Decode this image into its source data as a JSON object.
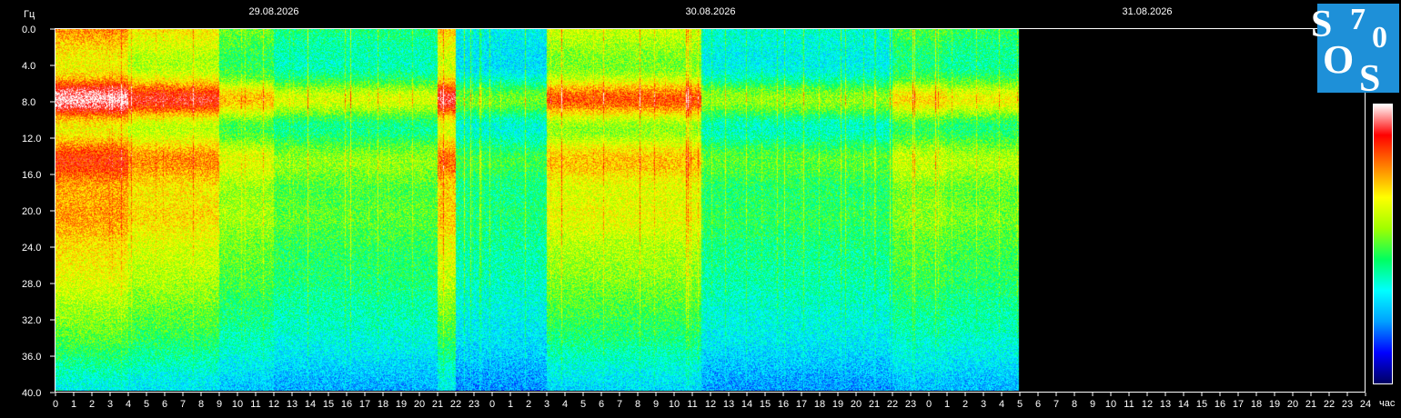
{
  "chart_data": {
    "type": "heatmap",
    "y_unit": "Гц",
    "x_unit": "час",
    "dates": [
      "29.08.2026",
      "30.08.2026",
      "31.08.2026"
    ],
    "y_ticks": [
      "0.0",
      "4.0",
      "8.0",
      "12.0",
      "16.0",
      "20.0",
      "24.0",
      "28.0",
      "32.0",
      "36.0",
      "40.0"
    ],
    "ylim": [
      0,
      40
    ],
    "x_hour_ticks": [
      "0",
      "1",
      "2",
      "3",
      "4",
      "5",
      "6",
      "7",
      "8",
      "9",
      "10",
      "11",
      "12",
      "13",
      "14",
      "15",
      "16",
      "17",
      "18",
      "19",
      "20",
      "21",
      "22",
      "23",
      "0",
      "1",
      "2",
      "3",
      "4",
      "5",
      "6",
      "7",
      "8",
      "9",
      "10",
      "11",
      "12",
      "13",
      "14",
      "15",
      "16",
      "17",
      "18",
      "19",
      "20",
      "21",
      "22",
      "23",
      "0",
      "1",
      "2",
      "3",
      "4",
      "5",
      "6",
      "7",
      "8",
      "9",
      "10",
      "11",
      "12",
      "13",
      "14",
      "15",
      "16",
      "17",
      "18",
      "19",
      "20",
      "21",
      "22",
      "23",
      "24"
    ],
    "total_hours": 72,
    "data_end_hour": 53,
    "resonance_bands_hz": [
      7.8,
      14.3,
      20.0,
      26.0,
      33.0
    ],
    "activity_segments": [
      {
        "from_hour": 0,
        "to_hour": 4,
        "level": 1.0
      },
      {
        "from_hour": 4,
        "to_hour": 9,
        "level": 0.85
      },
      {
        "from_hour": 9,
        "to_hour": 12,
        "level": 0.6
      },
      {
        "from_hour": 12,
        "to_hour": 21,
        "level": 0.45
      },
      {
        "from_hour": 21,
        "to_hour": 22,
        "level": 0.9
      },
      {
        "from_hour": 22,
        "to_hour": 27,
        "level": 0.3
      },
      {
        "from_hour": 27,
        "to_hour": 35.5,
        "level": 0.75
      },
      {
        "from_hour": 35.5,
        "to_hour": 46,
        "level": 0.35
      },
      {
        "from_hour": 46,
        "to_hour": 49,
        "level": 0.55
      },
      {
        "from_hour": 49,
        "to_hour": 53,
        "level": 0.5
      }
    ],
    "colorbar": [
      "#000060",
      "#0000ff",
      "#00a0ff",
      "#00ffff",
      "#00ff60",
      "#a0ff00",
      "#ffff00",
      "#ff8000",
      "#ff0000",
      "#ffffff"
    ],
    "colors": {
      "background": "#000000",
      "axis": "#ffffff",
      "logo_bg": "#1e90d8"
    }
  },
  "logo": {
    "letters": [
      "S",
      "7",
      "0",
      "O",
      "S"
    ]
  }
}
